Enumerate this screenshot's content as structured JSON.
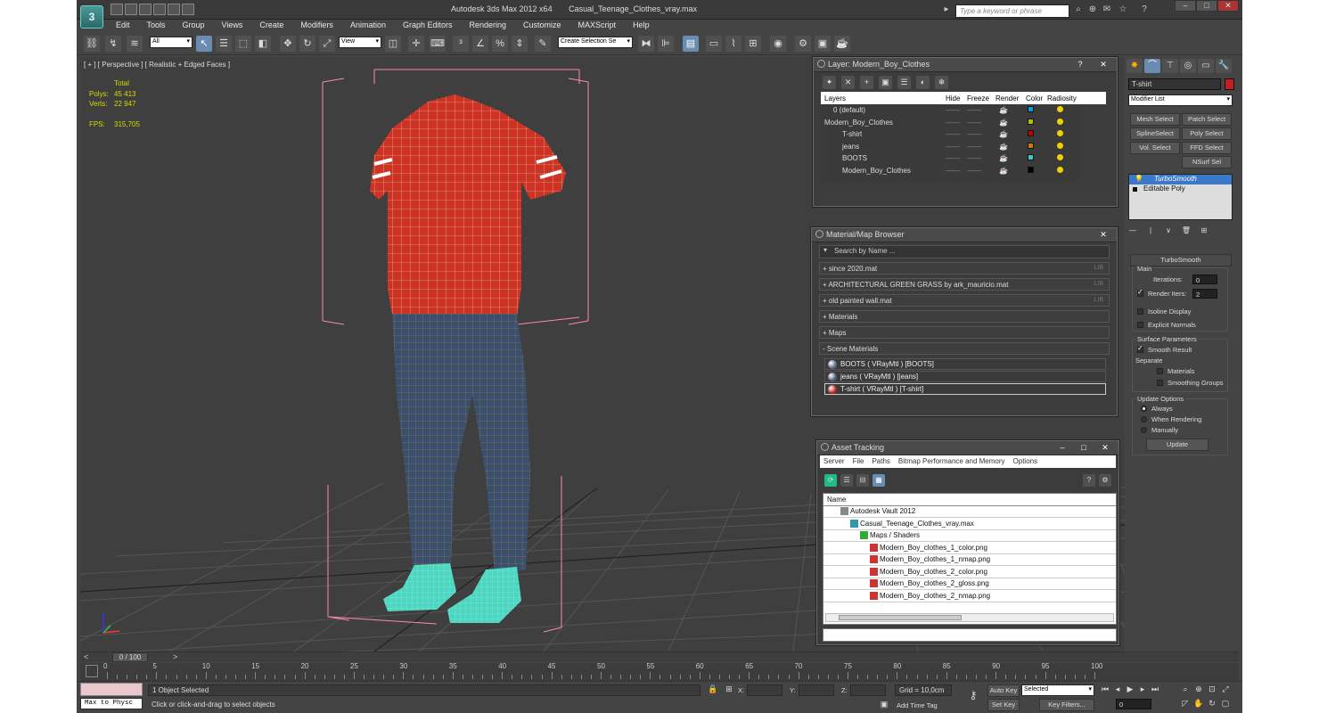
{
  "window": {
    "app_title": "Autodesk 3ds Max  2012 x64",
    "file_name": "Casual_Teenage_Clothes_vray.max"
  },
  "logo_text": "3",
  "search": {
    "placeholder": "Type a keyword or phrase"
  },
  "menu": [
    "Edit",
    "Tools",
    "Group",
    "Views",
    "Create",
    "Modifiers",
    "Animation",
    "Graph Editors",
    "Rendering",
    "Customize",
    "MAXScript",
    "Help"
  ],
  "toolbar": {
    "filter_dropdown": "All",
    "ref_coord_dropdown": "View",
    "selection_set_placeholder": "Create Selection Se"
  },
  "viewport": {
    "label": "[ + ] [ Perspective ] [ Realistic + Edged Faces ]",
    "stats": {
      "total_label": "Total",
      "polys_label": "Polys:",
      "polys": "45 413",
      "verts_label": "Verts:",
      "verts": "22 947",
      "fps_label": "FPS:",
      "fps": "315,705"
    },
    "colors": {
      "tshirt": "#cc3322",
      "jeans": "#3a4e6e",
      "boots": "#4fd6c0",
      "bbox": "#ff88aa"
    }
  },
  "layer_panel": {
    "title": "Layer: Modern_Boy_Clothes",
    "columns": [
      "Layers",
      "Hide",
      "Freeze",
      "Render",
      "Color",
      "Radiosity"
    ],
    "rows": [
      {
        "name": "0 (default)",
        "indent": 1,
        "color": "#00a0e0"
      },
      {
        "name": "Modern_Boy_Clothes",
        "indent": 0,
        "color": "#b0c000"
      },
      {
        "name": "T-shirt",
        "indent": 2,
        "color": "#c00000"
      },
      {
        "name": "jeans",
        "indent": 2,
        "color": "#c08000"
      },
      {
        "name": "BOOTS",
        "indent": 2,
        "color": "#30d0c0"
      },
      {
        "name": "Modern_Boy_Clothes",
        "indent": 2,
        "color": "#000000"
      }
    ]
  },
  "material_browser": {
    "title": "Material/Map Browser",
    "search_placeholder": "Search by Name ...",
    "lib_label": "LIB",
    "libraries": [
      "+ since 2020.mat",
      "+ ARCHITECTURAL GREEN GRASS by ark_mauricio.mat",
      "+ old painted wall.mat"
    ],
    "groups": [
      "+ Materials",
      "+ Maps",
      "- Scene Materials"
    ],
    "scene_materials": [
      {
        "name": "BOOTS  ( VRayMtl )  [BOOTS]",
        "color": "#5a6a8a"
      },
      {
        "name": "jeans  ( VRayMtl )  [jeans]",
        "color": "#4a5a7a"
      },
      {
        "name": "T-shirt  ( VRayMtl )  [T-shirt]",
        "color": "#c02020"
      }
    ]
  },
  "asset_tracking": {
    "title": "Asset Tracking",
    "menu": [
      "Server",
      "File",
      "Paths",
      "Bitmap Performance and Memory",
      "Options"
    ],
    "column": "Name",
    "rows": [
      {
        "name": "Autodesk Vault 2012",
        "indent": 1
      },
      {
        "name": "Casual_Teenage_Clothes_vray.max",
        "indent": 2
      },
      {
        "name": "Maps / Shaders",
        "indent": 3
      },
      {
        "name": "Modern_Boy_clothes_1_color.png",
        "indent": 4
      },
      {
        "name": "Modern_Boy_clothes_1_nmap.png",
        "indent": 4
      },
      {
        "name": "Modern_Boy_clothes_2_color.png",
        "indent": 4
      },
      {
        "name": "Modern_Boy_clothes_2_gloss.png",
        "indent": 4
      },
      {
        "name": "Modern_Boy_clothes_2_nmap.png",
        "indent": 4
      }
    ]
  },
  "command_panel": {
    "object_name": "T-shirt",
    "object_color": "#c02020",
    "modifier_list": "Modifier List",
    "buttons": [
      "Mesh Select",
      "Patch Select",
      "SplineSelect",
      "Poly Select",
      "Vol. Select",
      "FFD Select",
      "NSurf Sel"
    ],
    "stack": [
      "TurboSmooth",
      "Editable Poly"
    ],
    "rollout_title": "TurboSmooth",
    "main_label": "Main",
    "iterations_label": "Iterations:",
    "iterations": "0",
    "render_iters_label": "Render Iters:",
    "render_iters": "2",
    "isoline": "Isoline Display",
    "explicit": "Explicit Normals",
    "surface_label": "Surface Parameters",
    "smooth_result": "Smooth Result",
    "separate_label": "Separate",
    "materials": "Materials",
    "smoothing_groups": "Smoothing Groups",
    "update_label": "Update Options",
    "always": "Always",
    "when_rendering": "When Rendering",
    "manually": "Manually",
    "update_btn": "Update"
  },
  "timeline": {
    "frame": "0 / 100",
    "ticks": [
      "0",
      "5",
      "10",
      "15",
      "20",
      "25",
      "30",
      "35",
      "40",
      "45",
      "50",
      "55",
      "60",
      "65",
      "70",
      "75",
      "80",
      "85",
      "90",
      "95",
      "100"
    ]
  },
  "status": {
    "maxscript": "Max to Physc",
    "selected": "1 Object Selected",
    "prompt": "Click or click-and-drag to select objects",
    "x_label": "X:",
    "y_label": "Y:",
    "z_label": "Z:",
    "grid": "Grid = 10,0cm",
    "add_time_tag": "Add Time Tag",
    "auto_key": "Auto Key",
    "set_key": "Set Key",
    "selected_dd": "Selected",
    "key_filters": "Key Filters...",
    "frame_field": "0"
  }
}
